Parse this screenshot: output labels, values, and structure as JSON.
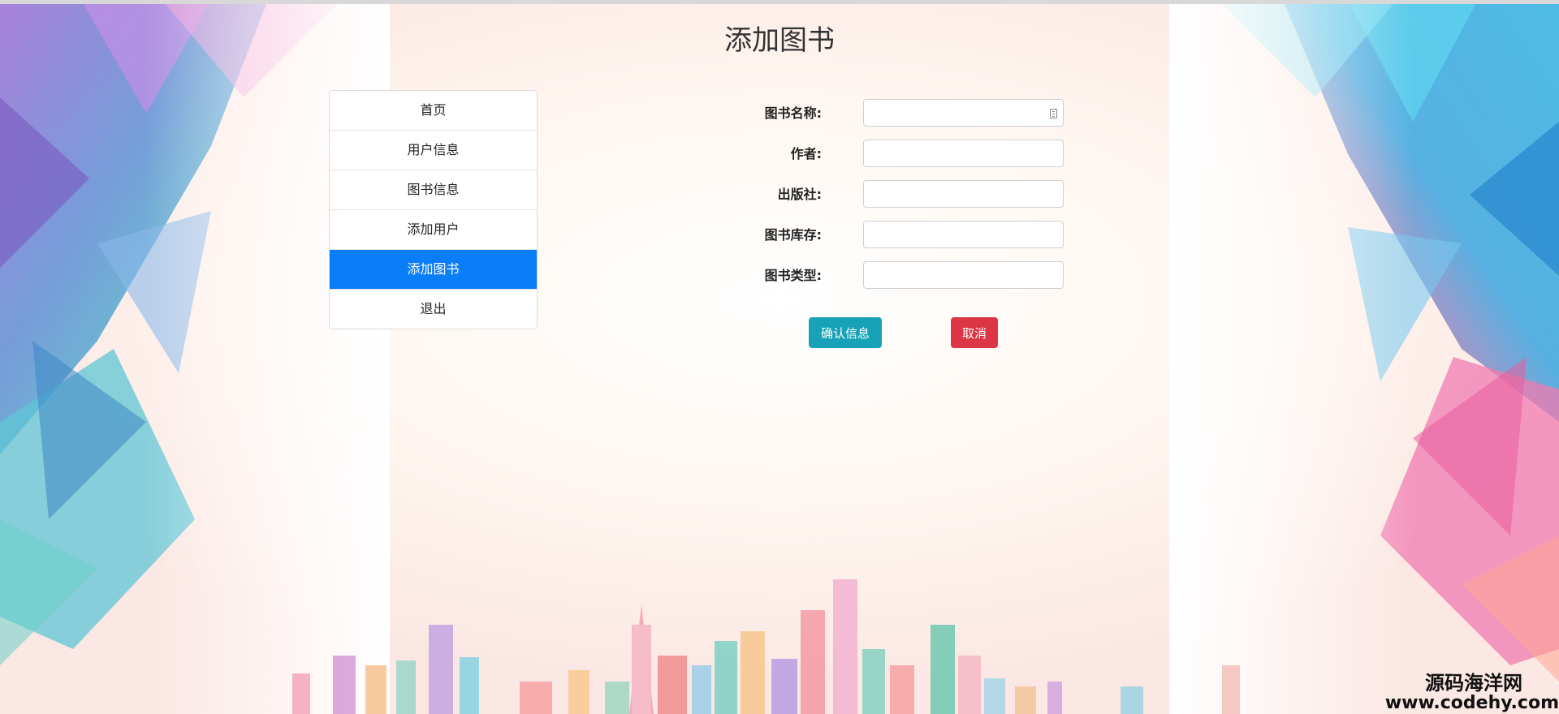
{
  "page": {
    "title": "添加图书"
  },
  "sidebar": {
    "items": [
      {
        "label": "首页",
        "active": false
      },
      {
        "label": "用户信息",
        "active": false
      },
      {
        "label": "图书信息",
        "active": false
      },
      {
        "label": "添加用户",
        "active": false
      },
      {
        "label": "添加图书",
        "active": true
      },
      {
        "label": "退出",
        "active": false
      }
    ]
  },
  "form": {
    "fields": [
      {
        "label": "图书名称:",
        "value": ""
      },
      {
        "label": "作者:",
        "value": ""
      },
      {
        "label": "出版社:",
        "value": ""
      },
      {
        "label": "图书库存:",
        "value": ""
      },
      {
        "label": "图书类型:",
        "value": ""
      }
    ],
    "confirm_label": "确认信息",
    "cancel_label": "取消"
  },
  "watermark": {
    "name": "源码海洋网",
    "url": "www.codehy.com"
  },
  "colors": {
    "active_menu": "#0a7df8",
    "confirm_button": "#17a2b8",
    "cancel_button": "#dc3545"
  },
  "icons": {
    "name_field_icon": "autofill-card-icon"
  }
}
